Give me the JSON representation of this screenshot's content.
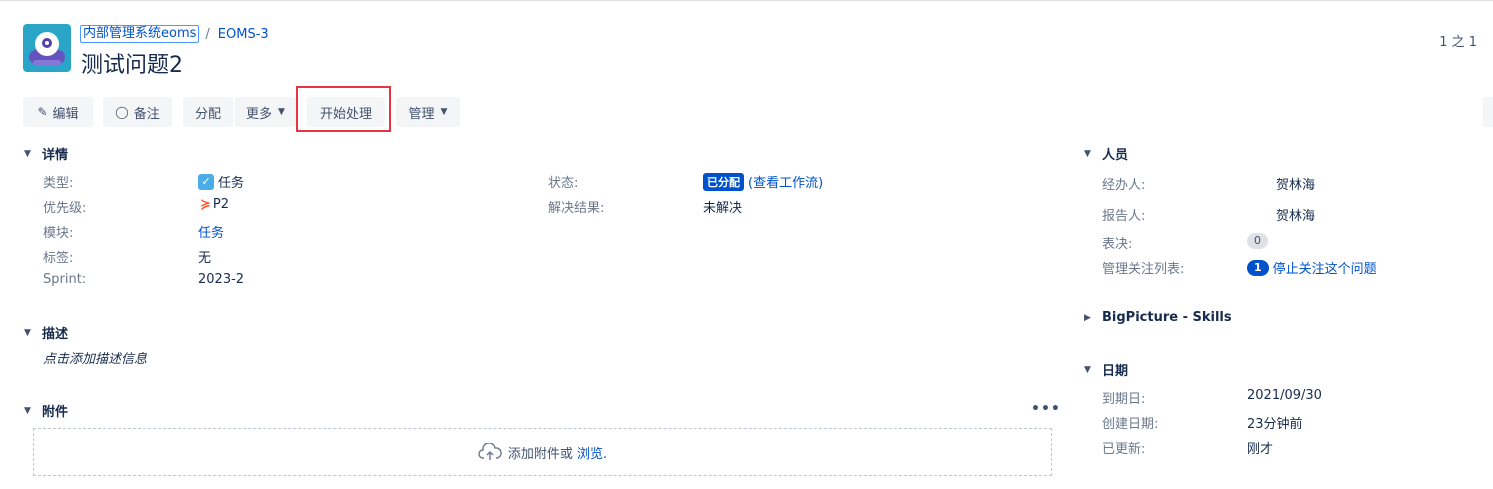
{
  "breadcrumb": {
    "project": "内部管理系统eoms",
    "separator": "/",
    "issue_key": "EOMS-3"
  },
  "issue": {
    "title": "测试问题2"
  },
  "pager": "1 之 1",
  "toolbar": {
    "edit": "编辑",
    "comment": "备注",
    "assign": "分配",
    "more": "更多",
    "start": "开始处理",
    "admin": "管理"
  },
  "details": {
    "heading": "详情",
    "type_label": "类型:",
    "type_value": "任务",
    "priority_label": "优先级:",
    "priority_value": "P2",
    "component_label": "模块:",
    "component_value": "任务",
    "labels_label": "标签:",
    "labels_value": "无",
    "sprint_label": "Sprint:",
    "sprint_value": "2023-2",
    "status_label": "状态:",
    "status_value": "已分配",
    "status_workflow": "(查看工作流)",
    "resolution_label": "解决结果:",
    "resolution_value": "未解决"
  },
  "description": {
    "heading": "描述",
    "placeholder": "点击添加描述信息"
  },
  "attachments": {
    "heading": "附件",
    "more": "•••",
    "drop_text": "添加附件或",
    "browse": "浏览."
  },
  "people": {
    "heading": "人员",
    "assignee_label": "经办人:",
    "assignee_value": "贺林海",
    "reporter_label": "报告人:",
    "reporter_value": "贺林海",
    "votes_label": "表决:",
    "votes_value": "0",
    "watchers_label": "管理关注列表:",
    "watchers_count": "1",
    "watchers_action": "停止关注这个问题"
  },
  "bigpicture": {
    "heading": "BigPicture - Skills"
  },
  "dates": {
    "heading": "日期",
    "due_label": "到期日:",
    "due_value": "2021/09/30",
    "created_label": "创建日期:",
    "created_value": "23分钟前",
    "updated_label": "已更新:",
    "updated_value": "刚才"
  },
  "colors": {
    "link": "#0052cc",
    "highlight": "#e5363f",
    "status": "#0052cc"
  }
}
